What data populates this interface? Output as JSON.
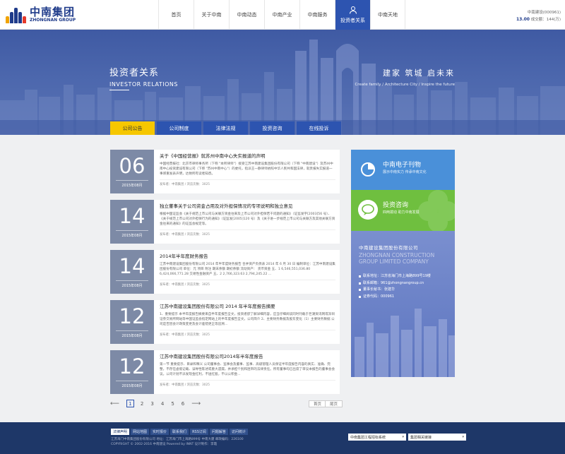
{
  "header": {
    "logo_cn": "中南集团",
    "logo_en": "ZHONGNAN GROUP",
    "nav": [
      "首页",
      "关于中南",
      "中南动态",
      "中南产业",
      "中南服务",
      "投资者关系",
      "中南天地"
    ],
    "active_nav": "投资者关系",
    "stock_name": "中南建设(000961)",
    "stock_price": "13.00",
    "stock_volume": "成交额：144(万)"
  },
  "hero": {
    "title_cn": "投资者关系",
    "title_en": "INVESTOR RELATIONS",
    "slogan_cn": "建家  筑城  启未来",
    "slogan_en": "Create family / Architecture City / Inspire the future"
  },
  "tabs": [
    "公司公告",
    "公司制度",
    "法律法规",
    "投资咨询",
    "在线投诉"
  ],
  "articles": [
    {
      "day": "06",
      "month": "2015年08月",
      "title": "关于《中国经营报》就苏州中南中心失实报道的声明",
      "excerpt": "中国经营报社：北京市律师事务所（下称 \"本所律师\"）接受江苏中南建设集团股份有限公司（下称 \"中南建设\"）及苏州中南中心投资建设有限公司（下称 \"苏州中南中心\"）的委托，指派王一静律师依照中华人民共和国法律，就贵报失实报道一事郑重发表声明，达致所有读者知悉。",
      "meta": "发布者：中南集团  /  浏览次数：3025"
    },
    {
      "day": "14",
      "month": "2015年08月",
      "title": "独立董事关于公司资金占用及对外担保情况的专项说明和独立意见",
      "excerpt": "根据中国证监会《关于规范上市公司与关联方资金往来及上市公司对外担保若干问题的通知》（证监发字[2003]56 号）、《关于规范上市公司对外担保行为的通知》（证监发[2005]120 号）及《关于进一步规范上市公司与关联方及其他关联方资金往来的通知》的证监会规定等。",
      "meta": "发布者：中南集团  /  浏览次数：3025"
    },
    {
      "day": "14",
      "month": "2015年08月",
      "title": "2014年半年度财务报告",
      "excerpt": "江苏中南建设集团股份有限公司 2014 年半年度财务报告 合并资产负债表 2014 年 6 月 30 日 编制单位：江苏中南建设集团股份有限公司 单位：元 项目 附注 期末余额 期初余额 流动资产： 货币资金 五、1 6,546,551,036.80 6,424,066,771.28 交易性金融资产 五、2 2,766,323.63 2,794,245.22 ...",
      "meta": "发布者：中南集团  /  浏览次数：3025"
    },
    {
      "day": "12",
      "month": "2015年08月",
      "title": "江苏中南建设集团股份有限公司 2014 年半年度报告摘要",
      "excerpt": "1、重要提示 本半年度报告摘要来自半年度报告全文，投资者欲了解详细内容，应当仔细阅读同时刊载于巨潮资讯网或深圳证券交易所网站等中国证监会指定网站上的半年度报告全文。公司简介 2、主要财务数据及股东变化（1）主要财务数据 公司是否因会计政策变更及会计差错更正等追溯...",
      "meta": "发布者：中南集团  /  浏览次数：3025"
    },
    {
      "day": "12",
      "month": "2015年08月",
      "title": "江苏中南建设集团股份有限公司2014年半年度报告",
      "excerpt": "第一节 重要提示、目录和释义 公司董事会、监事会及董事、监事、高级管理人员保证半年度报告内容的真实、准确、完整，不存在虚假记载、误导性陈述或重大遗漏，并承担个别和连带的法律责任。所有董事均已出席了审议本报告的董事会会议。公司计划不派发现金红利，不送红股，不以公积金...",
      "meta": "发布者：中南集团  /  浏览次数：3025"
    }
  ],
  "pagination": {
    "pages": [
      "1",
      "2",
      "3",
      "4",
      "5",
      "6"
    ],
    "current": "1",
    "first": "首页",
    "last": "尾页"
  },
  "sidebar": {
    "epub_title": "中南电子刊物",
    "epub_sub": "展示中南实力 传承中南文化",
    "consult_title": "投资咨询",
    "consult_sub": "四两拨动 助力中南发展",
    "company_cn": "中南建设集团股份有限公司",
    "company_en": "ZHONGNAN CONSTRUCTION GROUP LIMITED COMPANY",
    "info": [
      "联系地址：江苏省海门市上海路899号19楼",
      "联系邮箱：961@zhongnangroup.cn",
      "董事长秘书：张建华",
      "证券代码：000961"
    ]
  },
  "footer": {
    "links": [
      "法律声明",
      "网站地图",
      "实时报价",
      "联系我们",
      "RSS订阅",
      "问题解答",
      "访问统计"
    ],
    "address": "江苏海门中南集团股份有限公司  地址：江苏海门市上海路899号 中南大厦  邮政编码：226100",
    "copyright": "COPYRIGHT © 2002-2016 中南建设  Powered by INNT 设计制作：李霞",
    "select1": "中南集团工程招标系统",
    "select2": "集团相关链接"
  },
  "colors": {
    "brand_blue": "#2d54b0",
    "tab_active": "#f6c700",
    "date_block": "#7d8aa6",
    "epub_blue": "#4a90d9",
    "consult_green": "#6fbf3f",
    "footer_bg": "#1e3768"
  }
}
